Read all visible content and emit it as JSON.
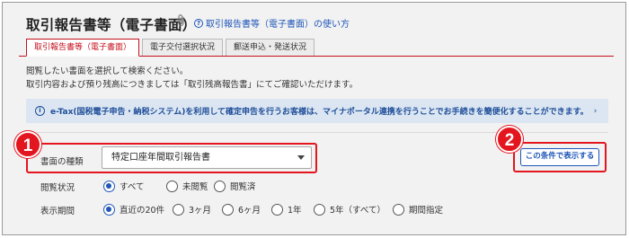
{
  "page": {
    "title": "取引報告書等（電子書面）",
    "help_link": "取引報告書等（電子書面）の使い方"
  },
  "tabs": [
    {
      "label": "取引報告書等（電子書面）",
      "active": true
    },
    {
      "label": "電子交付選択状況",
      "active": false
    },
    {
      "label": "郵送申込・発送状況",
      "active": false
    }
  ],
  "description": {
    "line1": "閲覧したい書面を選択して検索ください。",
    "line2": "取引内容および預り残高につきましては「取引残高報告書」にてご確認いただけます。"
  },
  "notice": {
    "text": "e-Tax(国税電子申告・納税システム)を利用して確定申告を行うお客様は、マイナポータル連携を行うことでお手続きを簡便化することができます。",
    "chevron": "›"
  },
  "form": {
    "document_type": {
      "label": "書面の種類",
      "value": "特定口座年間取引報告書"
    },
    "read_status": {
      "label": "閲覧状況",
      "options": [
        "すべて",
        "未閲覧",
        "閲覧済"
      ],
      "selected": "すべて"
    },
    "period": {
      "label": "表示期間",
      "options": [
        "直近の20件",
        "3ヶ月",
        "6ヶ月",
        "1年",
        "5年（すべて）",
        "期間指定"
      ],
      "selected": "直近の20件"
    },
    "search_button": "この条件で表示する"
  },
  "annotations": {
    "badge1": "1",
    "badge2": "2",
    "accent_color": "#e3151e"
  },
  "colors": {
    "link_blue": "#1f56b8",
    "tab_active_red": "#c4121d",
    "notice_bg": "#dbe6f2"
  }
}
